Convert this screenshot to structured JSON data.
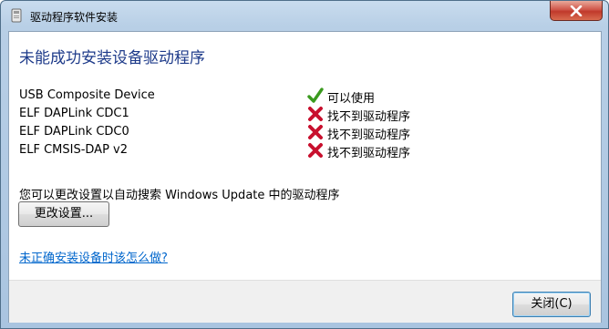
{
  "window": {
    "title": "驱动程序软件安装"
  },
  "main": {
    "heading": "未能成功安装设备驱动程序",
    "devices": [
      {
        "name": "USB Composite Device",
        "status": "可以使用",
        "status_icon": "check-icon",
        "status_color": "#3a9a1e"
      },
      {
        "name": "ELF DAPLink CDC1",
        "status": "找不到驱动程序",
        "status_icon": "error-x-icon",
        "status_color": "#c8102e"
      },
      {
        "name": "ELF DAPLink CDC0",
        "status": "找不到驱动程序",
        "status_icon": "error-x-icon",
        "status_color": "#c8102e"
      },
      {
        "name": "ELF CMSIS-DAP v2",
        "status": "找不到驱动程序",
        "status_icon": "error-x-icon",
        "status_color": "#c8102e"
      }
    ],
    "hint": "您可以更改设置以自动搜索 Windows Update 中的驱动程序",
    "change_settings_label": "更改设置...",
    "help_link": "未正确安装设备时该怎么做?"
  },
  "footer": {
    "close_label": "关闭(C)"
  },
  "colors": {
    "heading": "#1e3b8a",
    "link": "#0066cc",
    "title_close": "#c0392b"
  }
}
